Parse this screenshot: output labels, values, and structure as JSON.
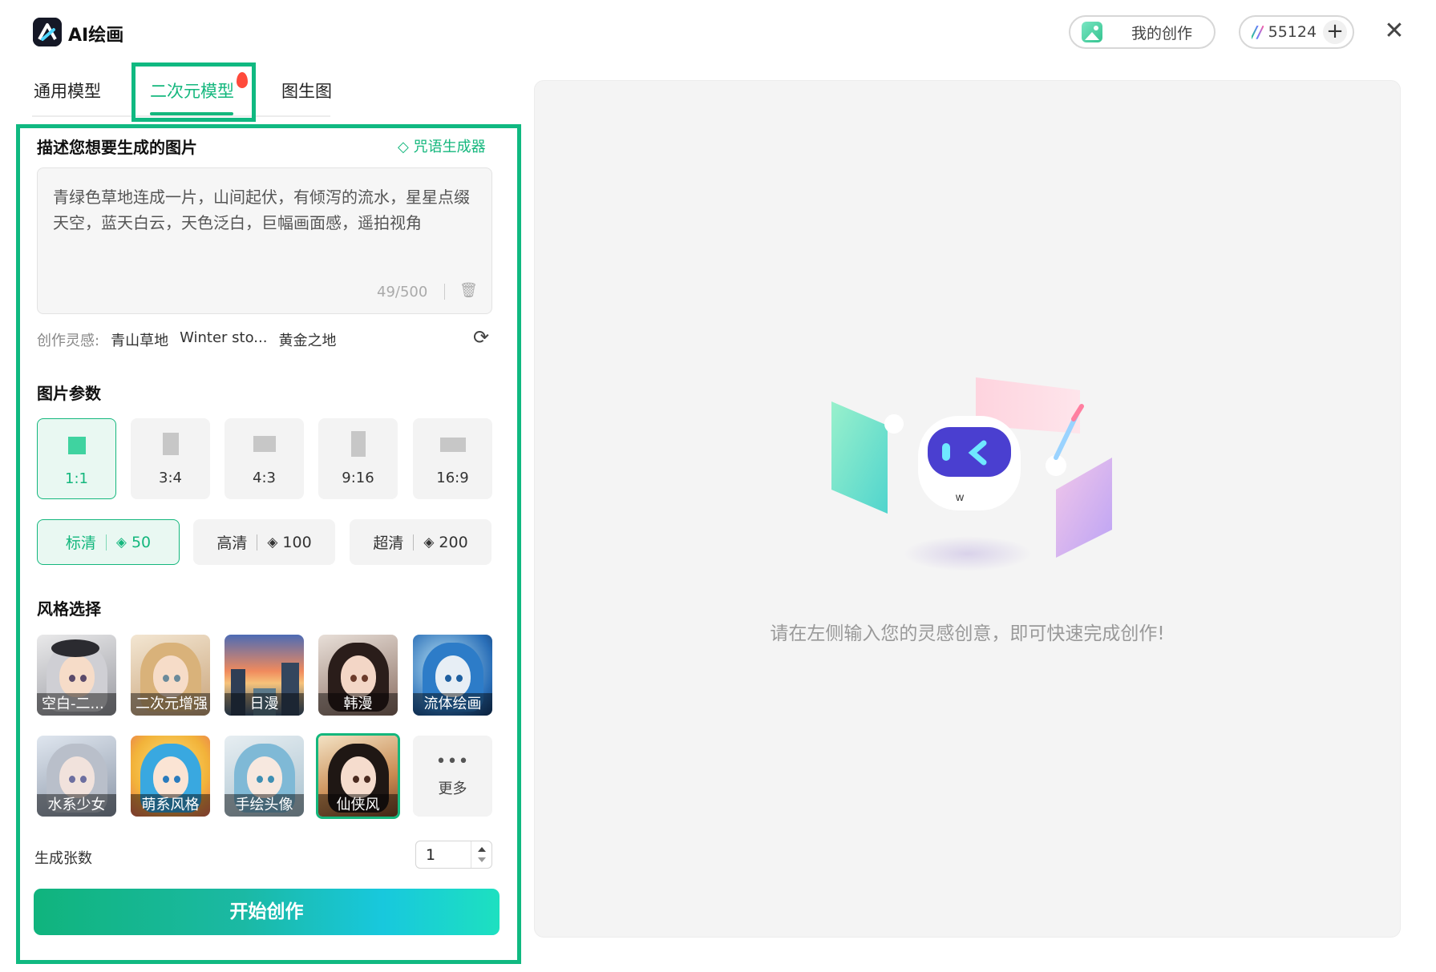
{
  "app": {
    "title": "AI绘画"
  },
  "header": {
    "my_works_label": "我的创作",
    "credits_icon": "brand-swoosh",
    "credits_value": "55124",
    "add_label": "+",
    "close_label": "✕"
  },
  "tabs": [
    {
      "label": "通用模型",
      "active": false
    },
    {
      "label": "二次元模型",
      "active": true,
      "badge": "fire-icon"
    },
    {
      "label": "图生图",
      "active": false
    }
  ],
  "prompt": {
    "section_title": "描述您想要生成的图片",
    "generator_label": "咒语生成器",
    "text": "青绿色草地连成一片，山间起伏，有倾泻的流水，星星点缀天空，蓝天白云，天色泛白，巨幅画面感，遥拍视角",
    "counter": "49/500"
  },
  "inspiration": {
    "label": "创作灵感:",
    "tags": [
      "青山草地",
      "Winter sto...",
      "黄金之地"
    ]
  },
  "params": {
    "section_title": "图片参数",
    "ratios": [
      {
        "label": "1:1",
        "selected": true
      },
      {
        "label": "3:4",
        "selected": false
      },
      {
        "label": "4:3",
        "selected": false
      },
      {
        "label": "9:16",
        "selected": false
      },
      {
        "label": "16:9",
        "selected": false
      }
    ],
    "qualities": [
      {
        "label": "标清",
        "cost": "50",
        "selected": true
      },
      {
        "label": "高清",
        "cost": "100",
        "selected": false
      },
      {
        "label": "超清",
        "cost": "200",
        "selected": false
      }
    ]
  },
  "styles": {
    "section_title": "风格选择",
    "items": [
      {
        "label": "空白-二...",
        "selected": false
      },
      {
        "label": "二次元增强",
        "selected": false
      },
      {
        "label": "日漫",
        "selected": false
      },
      {
        "label": "韩漫",
        "selected": false
      },
      {
        "label": "流体绘画",
        "selected": false
      },
      {
        "label": "水系少女",
        "selected": false
      },
      {
        "label": "萌系风格",
        "selected": false
      },
      {
        "label": "手绘头像",
        "selected": false
      },
      {
        "label": "仙侠风",
        "selected": true
      }
    ],
    "more_label": "更多"
  },
  "count": {
    "label": "生成张数",
    "value": "1"
  },
  "start_label": "开始创作",
  "canvas": {
    "hint": "请在左侧输入您的灵感创意，即可快速完成创作!"
  },
  "colors": {
    "accent": "#14b77d",
    "highlight": "#10b981"
  }
}
